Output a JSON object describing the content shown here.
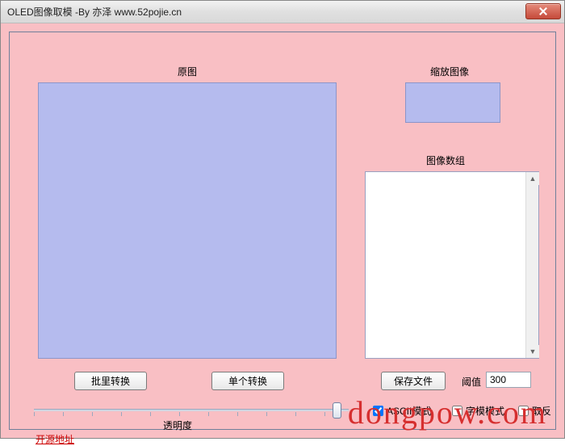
{
  "window": {
    "title": "OLED图像取模 -By 亦泽      www.52pojie.cn"
  },
  "labels": {
    "original": "原图",
    "zoomed": "缩放图像",
    "array": "图像数组",
    "opacity": "透明度",
    "threshold": "阈值"
  },
  "buttons": {
    "batch": "批里转换",
    "single": "单个转换",
    "save": "保存文件"
  },
  "inputs": {
    "threshold_value": "300"
  },
  "checkboxes": {
    "ascii": "ASCII模式",
    "font": "字模模式",
    "invert": "取反"
  },
  "checked": {
    "ascii": true,
    "font": false,
    "invert": false
  },
  "link": {
    "source": "开源地址"
  },
  "watermark": "dongpow.com"
}
